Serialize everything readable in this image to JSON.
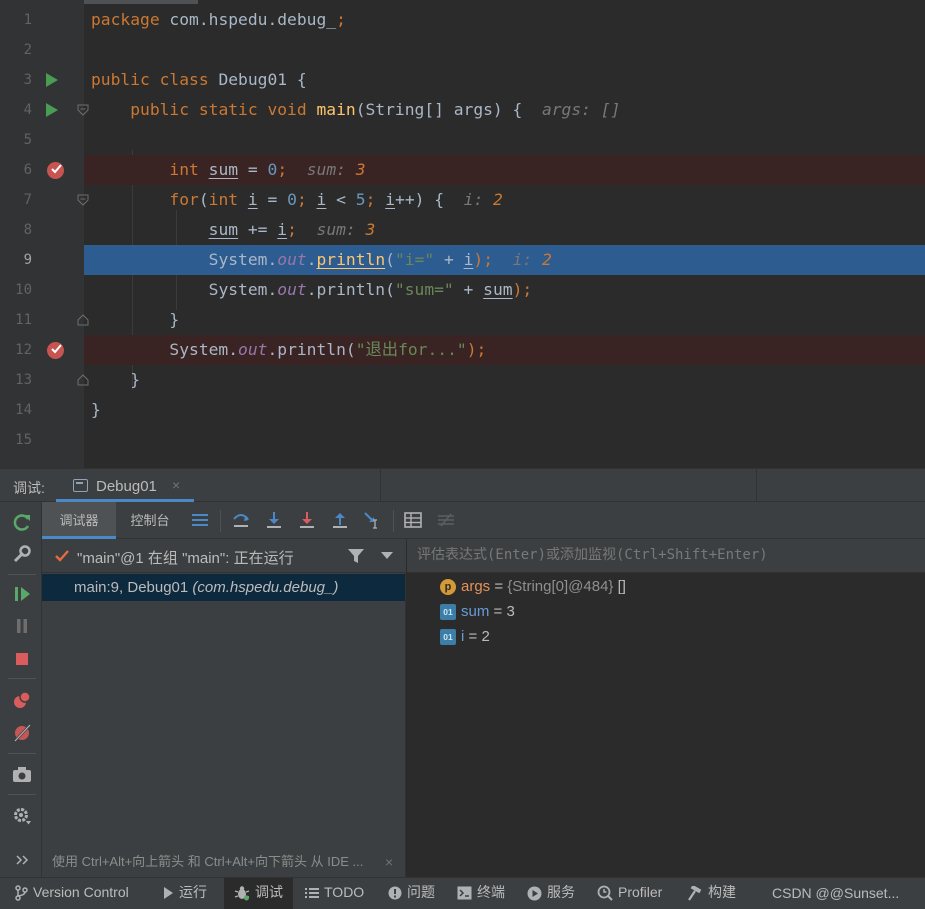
{
  "editor": {
    "lines": [
      {
        "num": "1"
      },
      {
        "num": "2"
      },
      {
        "num": "3"
      },
      {
        "num": "4"
      },
      {
        "num": "5"
      },
      {
        "num": "6"
      },
      {
        "num": "7"
      },
      {
        "num": "8"
      },
      {
        "num": "9"
      },
      {
        "num": "10"
      },
      {
        "num": "11"
      },
      {
        "num": "12"
      },
      {
        "num": "13"
      },
      {
        "num": "14"
      },
      {
        "num": "15"
      }
    ],
    "l1_kw": "package",
    "l1_pkg": " com.hspedu.debug_",
    "l1_semi": ";",
    "l3_kw": "public class",
    "l3_rest": " Debug01 {",
    "l4_indent": "    ",
    "l4_kw": "public static void",
    "l4_sp": " ",
    "l4_fn": "main",
    "l4_rest": "(String[] args) {",
    "l4_hint": "  args: []",
    "l6_indent": "        ",
    "l6_kw": "int",
    "l6_sp": " ",
    "l6_var": "sum",
    "l6_eq": " = ",
    "l6_num": "0",
    "l6_semi": ";",
    "l6_hint": "  sum: ",
    "l6_hintval": "3",
    "l7_indent": "        ",
    "l7_kw1": "for",
    "l7_p1": "(",
    "l7_kw2": "int",
    "l7_sp": " ",
    "l7_i1": "i",
    "l7_eq": " = ",
    "l7_n0": "0",
    "l7_semi1": "; ",
    "l7_i2": "i",
    "l7_lt": " < ",
    "l7_n5": "5",
    "l7_semi2": "; ",
    "l7_i3": "i",
    "l7_rest": "++) {",
    "l7_hint": "  i: ",
    "l7_hintval": "2",
    "l8_indent": "            ",
    "l8_var": "sum",
    "l8_op": " += ",
    "l8_i": "i",
    "l8_semi": ";",
    "l8_hint": "  sum: ",
    "l8_hintval": "3",
    "l9_indent": "            ",
    "l9_sys": "System.",
    "l9_out": "out",
    "l9_dot": ".",
    "l9_fn": "println",
    "l9_p": "(",
    "l9_str": "\"i=\"",
    "l9_plus": " + ",
    "l9_i": "i",
    "l9_end": ");",
    "l9_hint": "  i: ",
    "l9_hintval": "2",
    "l10_indent": "            ",
    "l10_sys": "System.",
    "l10_out": "out",
    "l10_rest": ".println(",
    "l10_str": "\"sum=\"",
    "l10_plus": " + ",
    "l10_var": "sum",
    "l10_end": ");",
    "l11_text": "        }",
    "l12_indent": "        ",
    "l12_sys": "System.",
    "l12_out": "out",
    "l12_rest": ".println(",
    "l12_str": "\"退出for...\"",
    "l12_end": ");",
    "l13_text": "    }",
    "l14_text": "}"
  },
  "debug_header": {
    "title": "调试:",
    "tab_label": "Debug01",
    "tab_close": "×"
  },
  "sub_toolbar": {
    "tab_debugger": "调试器",
    "tab_console": "控制台"
  },
  "frames": {
    "thread_label": "\"main\"@1 在组 \"main\": 正在运行",
    "frame_location": "main:9, Debug01 ",
    "frame_package": "(com.hspedu.debug_)",
    "hint_text": "使用 Ctrl+Alt+向上箭头 和 Ctrl+Alt+向下箭头 从 IDE ...",
    "hint_close": "×"
  },
  "variables": {
    "eval_placeholder": "评估表达式(Enter)或添加监视(Ctrl+Shift+Enter)",
    "items": [
      {
        "icon": "p",
        "name": "args",
        "eq": " = ",
        "type": "{String[0]@484}",
        "value": " []"
      },
      {
        "icon": "01",
        "name": "sum",
        "eq": " = ",
        "type": "",
        "value": "3"
      },
      {
        "icon": "01",
        "name": "i",
        "eq": " = ",
        "type": "",
        "value": "2"
      }
    ]
  },
  "statusbar": {
    "items": [
      "Version Control",
      "运行",
      "调试",
      "TODO",
      "问题",
      "终端",
      "服务",
      "Profiler",
      "构建"
    ],
    "right_text": "CSDN @@Sunset..."
  },
  "colors": {
    "keyword": "#cc7832",
    "number": "#6897bb",
    "string": "#6a8759",
    "field": "#9876aa",
    "method": "#ffc66d",
    "current_line": "#2d5c91",
    "breakpoint_line": "#3a2323",
    "breakpoint": "#c75450",
    "accent": "#4a88c7"
  }
}
